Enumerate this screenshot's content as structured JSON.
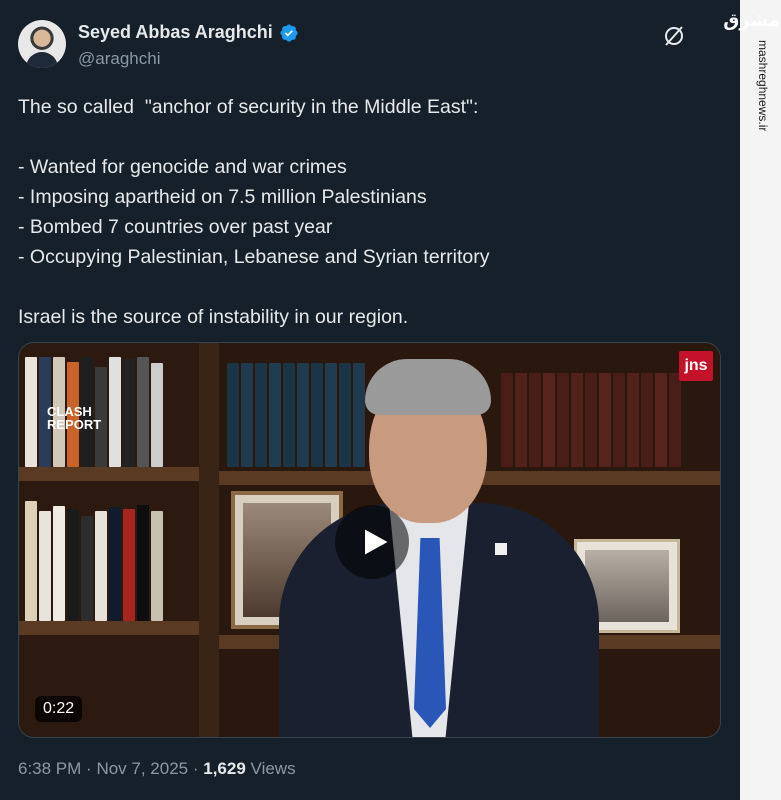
{
  "author": {
    "name": "Seyed Abbas Araghchi",
    "handle": "@araghchi",
    "verified_color": "#1d9bf0"
  },
  "post": {
    "lines": [
      "The so called  \"anchor of security in the Middle East\":",
      "",
      "- Wanted for genocide and war crimes",
      "- Imposing apartheid on 7.5 million Palestinians",
      "- Bombed 7 countries over past year",
      "- Occupying Palestinian, Lebanese and Syrian territory",
      "",
      "Israel is the source of instability in our region."
    ]
  },
  "video": {
    "duration": "0:22",
    "channel_badge": "jns",
    "overlay_logo": "CLASH REPORT",
    "overlay_logo_line1": "CLASH",
    "overlay_logo_line2": "REPORT"
  },
  "meta": {
    "time": "6:38 PM",
    "date": "Nov 7, 2025",
    "views_count": "1,629",
    "views_label": "Views"
  },
  "watermark": {
    "logo": "مشرق",
    "site": "mashreghnews.ir"
  },
  "colors": {
    "background": "#15202b",
    "text": "#e7e9ea",
    "muted": "#8b98a5",
    "accent": "#1d9bf0"
  }
}
